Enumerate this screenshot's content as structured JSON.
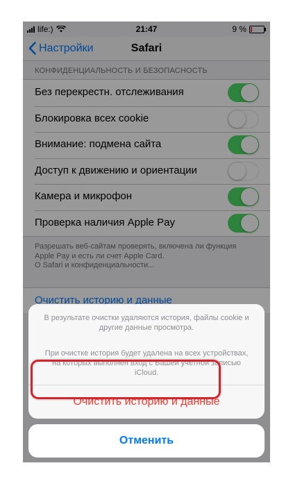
{
  "status": {
    "carrier": "life:)",
    "time": "21:47",
    "battery": "9 %",
    "battery_level": 0.09
  },
  "nav": {
    "back_label": "Настройки",
    "title": "Safari"
  },
  "privacy": {
    "header": "КОНФИДЕНЦИАЛЬНОСТЬ И БЕЗОПАСНОСТЬ",
    "rows": [
      {
        "label": "Без перекрестн. отслеживания",
        "on": true
      },
      {
        "label": "Блокировка всех cookie",
        "on": false
      },
      {
        "label": "Внимание: подмена сайта",
        "on": true
      },
      {
        "label": "Доступ к движению и ориентации",
        "on": false
      },
      {
        "label": "Камера и микрофон",
        "on": true
      },
      {
        "label": "Проверка наличия Apple Pay",
        "on": true
      }
    ],
    "footer_line1": "Разрешать веб-сайтам проверять, включена ли функция",
    "footer_line2": "Apple Pay и есть ли счет Apple Card.",
    "footer_line3": "О Safari и конфиденциальности..."
  },
  "clear_history_label": "Очистить историю и данные",
  "sheet": {
    "message1_line1": "В результате очистки удаляются история, файлы cookie и",
    "message1_line2": "другие данные просмотра.",
    "message2_line1": "При очистке история будет удалена на всех устройствах,",
    "message2_line2": "на которых выполнен вход с Вашей учетной записью",
    "message2_line3": "iCloud.",
    "confirm_label": "Очистить историю и данные",
    "cancel_label": "Отменить"
  },
  "colors": {
    "accent": "#007aff",
    "destructive": "#ff3b30",
    "toggle_on": "#4cd964",
    "highlight": "#d7232b"
  }
}
